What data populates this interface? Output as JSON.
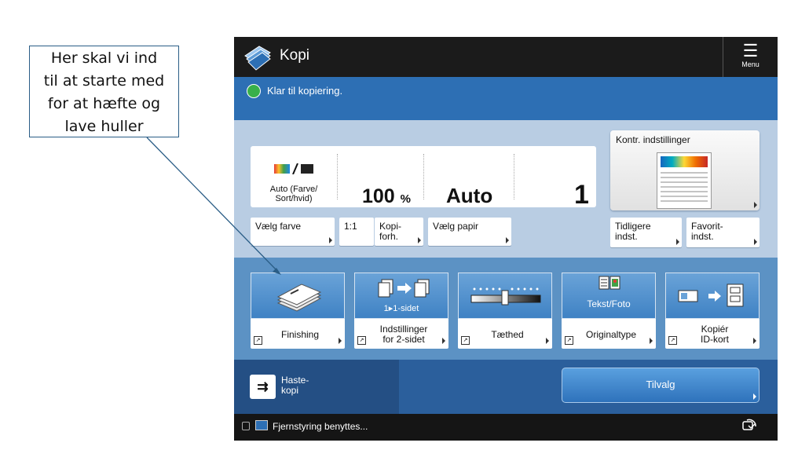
{
  "annotation": {
    "lines": [
      "Her skal vi ind",
      "til at starte med",
      "for at hæfte og",
      "lave huller"
    ]
  },
  "titlebar": {
    "title": "Kopi",
    "menu_label": "Menu",
    "app_icon": "copy-app-icon",
    "menu_icon": "hamburger-icon"
  },
  "status": {
    "text": "Klar til kopiering."
  },
  "settings": {
    "color_label_1": "Auto (Farve/",
    "color_label_2": "Sort/hvid)",
    "ratio_value": "100",
    "ratio_unit": "%",
    "paper_value": "Auto",
    "copies": "1"
  },
  "buttons": {
    "select_color": "Vælg farve",
    "one_to_one": "1:1",
    "copy_ratio_1": "Kopi-",
    "copy_ratio_2": "forh.",
    "select_paper": "Vælg papir",
    "check_settings": "Kontr. indstillinger",
    "previous_1": "Tidligere",
    "previous_2": "indst.",
    "favorite_1": "Favorit-",
    "favorite_2": "indst."
  },
  "functions": [
    {
      "label": "Finishing",
      "top_text": ""
    },
    {
      "label": "Indstillinger\nfor 2-sidet",
      "top_text": "1▸1-sidet"
    },
    {
      "label": "Tæthed",
      "top_text": ""
    },
    {
      "label": "Originaltype",
      "top_text": "Tekst/Foto"
    },
    {
      "label": "Kopiér\nID-kort",
      "top_text": ""
    }
  ],
  "bottom": {
    "rush_1": "Haste-",
    "rush_2": "kopi",
    "options": "Tilvalg"
  },
  "footer": {
    "text": "Fjernstyring benyttes..."
  },
  "colors": {
    "titlebar": "#1b1b1b",
    "status": "#2d6fb4",
    "main": "#b9cde3",
    "functions": "#5c92c4",
    "ready_green": "#38b04a"
  }
}
